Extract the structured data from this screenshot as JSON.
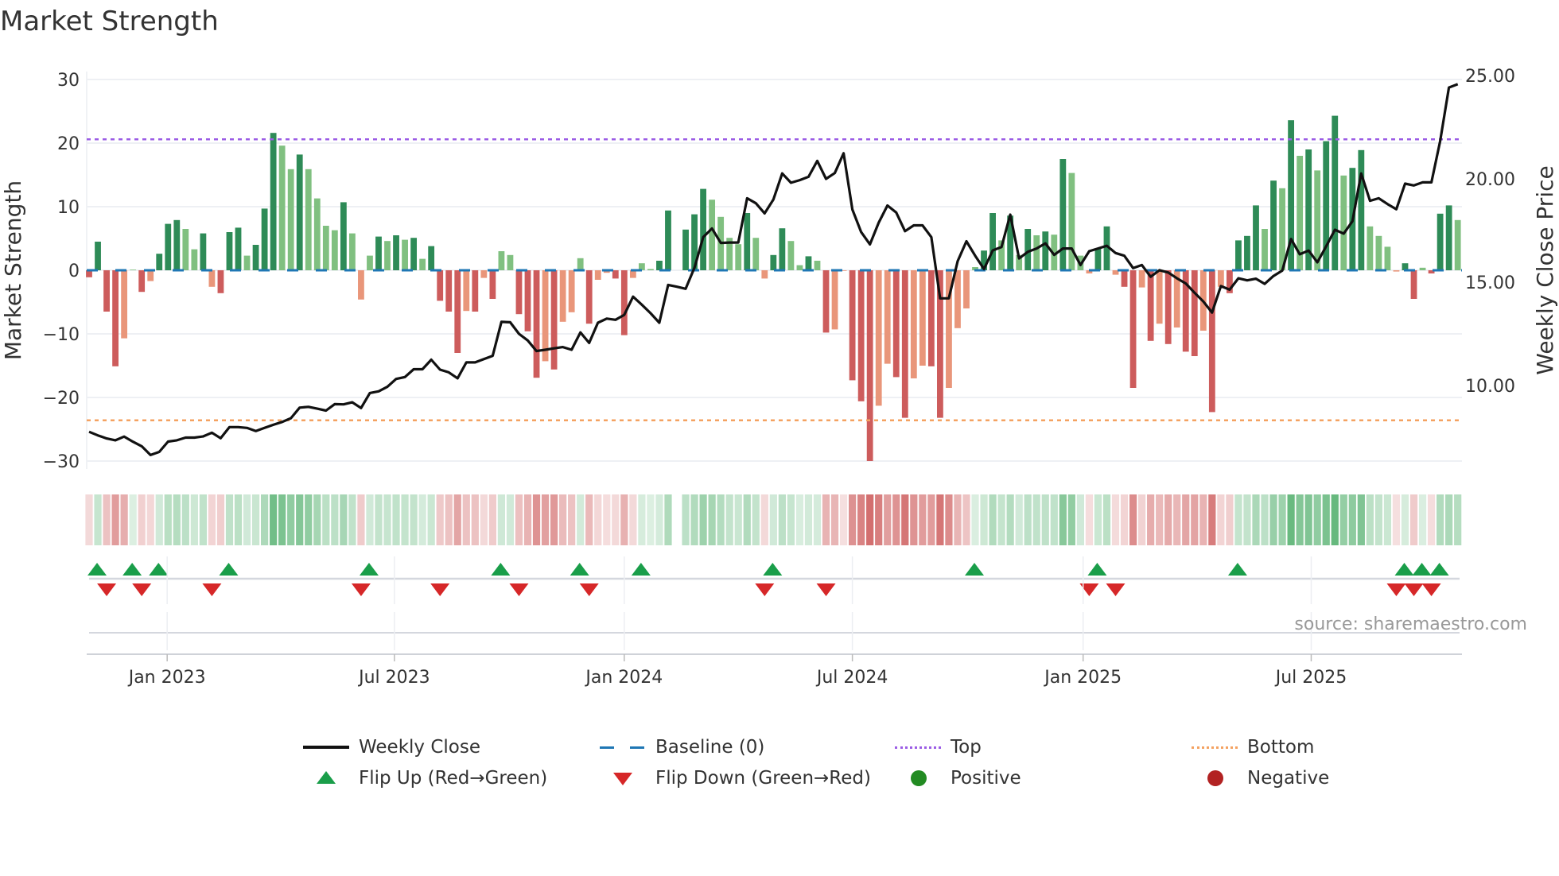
{
  "chart_data": {
    "type": "bar",
    "title": "Market Strength",
    "ylabel": "Market Strength",
    "y2label": "Weekly Close Price",
    "ylim": [
      -32,
      32
    ],
    "yticks": [
      30,
      20,
      10,
      0,
      -10,
      -20,
      -30
    ],
    "ytick_labels": [
      "30",
      "20",
      "10",
      "0",
      "−10",
      "−20",
      "−30"
    ],
    "y2ticks": [
      25,
      20,
      15,
      10
    ],
    "y2tick_labels": [
      "25.00",
      "20.00",
      "15.00",
      "10.00"
    ],
    "xticks": [
      {
        "label": "Jan 2023",
        "index": 8.9
      },
      {
        "label": "Jul 2023",
        "index": 34.8
      },
      {
        "label": "Jan 2024",
        "index": 61.0
      },
      {
        "label": "Jul 2024",
        "index": 87.0
      },
      {
        "label": "Jan 2025",
        "index": 113.3
      },
      {
        "label": "Jul 2025",
        "index": 139.3
      }
    ],
    "top_level": 20.6,
    "bottom_level": -23.6,
    "baseline": 0,
    "strength": [
      -1.1,
      4.5,
      -6.5,
      -15.1,
      -10.7,
      0.1,
      -3.4,
      -1.7,
      2.6,
      7.3,
      7.9,
      6.5,
      3.3,
      5.8,
      -2.6,
      -3.6,
      6.0,
      6.7,
      2.3,
      4.0,
      9.7,
      21.6,
      19.6,
      15.9,
      18.2,
      15.9,
      11.3,
      7.0,
      6.3,
      10.7,
      5.8,
      -4.6,
      2.3,
      5.3,
      4.6,
      5.5,
      4.8,
      5.1,
      1.8,
      3.8,
      -4.8,
      -6.5,
      -13.0,
      -6.4,
      -6.5,
      -1.2,
      -4.5,
      3.0,
      2.4,
      -6.9,
      -9.6,
      -16.9,
      -14.3,
      -15.6,
      -8.1,
      -6.6,
      1.9,
      -8.4,
      -1.5,
      -0.4,
      -1.3,
      -10.2,
      -1.2,
      1.1,
      0.2,
      1.5,
      9.4,
      0,
      6.4,
      8.8,
      12.8,
      11.1,
      8.4,
      5.1,
      4.1,
      9.0,
      5.1,
      -1.3,
      2.4,
      6.6,
      4.6,
      0.8,
      2.2,
      1.5,
      -9.8,
      -9.3,
      -0.1,
      -17.3,
      -20.6,
      -30.0,
      -21.3,
      -14.7,
      -16.8,
      -23.2,
      -17.0,
      -15.0,
      -15.1,
      -23.2,
      -18.5,
      -9.1,
      -6.0,
      0.5,
      3.1,
      9.0,
      4.7,
      8.6,
      2.4,
      6.5,
      5.5,
      6.1,
      5.6,
      17.5,
      15.3,
      2.3,
      -0.5,
      3.5,
      6.9,
      -0.7,
      -2.6,
      -18.5,
      -2.7,
      -11.1,
      -8.4,
      -11.6,
      -9.0,
      -12.8,
      -13.5,
      -9.5,
      -22.3,
      -2.6,
      -3.6,
      4.7,
      5.4,
      10.2,
      6.5,
      14.1,
      12.9,
      23.6,
      18.0,
      19.0,
      15.7,
      20.3,
      24.3,
      14.9,
      16.1,
      18.9,
      6.9,
      5.4,
      3.7,
      -0.2,
      1.1,
      -4.5,
      0.4,
      -0.5,
      8.9,
      10.2,
      7.9
    ],
    "weekly_close": [
      7.76,
      7.59,
      7.44,
      7.35,
      7.53,
      7.28,
      7.06,
      6.64,
      6.79,
      7.29,
      7.35,
      7.48,
      7.48,
      7.54,
      7.72,
      7.45,
      7.99,
      7.99,
      7.95,
      7.8,
      7.95,
      8.1,
      8.24,
      8.42,
      8.93,
      8.97,
      8.88,
      8.79,
      9.1,
      9.09,
      9.19,
      8.91,
      9.64,
      9.72,
      9.94,
      10.32,
      10.41,
      10.79,
      10.79,
      11.25,
      10.77,
      10.64,
      10.35,
      11.12,
      11.12,
      11.28,
      11.44,
      13.08,
      13.06,
      12.5,
      12.18,
      11.67,
      11.73,
      11.8,
      11.86,
      11.73,
      12.57,
      12.06,
      13.04,
      13.24,
      13.18,
      13.42,
      14.3,
      13.91,
      13.5,
      13.04,
      14.87,
      14.78,
      14.68,
      15.7,
      17.18,
      17.6,
      16.9,
      16.92,
      16.92,
      19.06,
      18.82,
      18.33,
      19.0,
      20.26,
      19.81,
      19.94,
      20.1,
      20.87,
      20.0,
      20.28,
      21.24,
      18.52,
      17.43,
      16.83,
      17.88,
      18.71,
      18.37,
      17.47,
      17.75,
      17.75,
      17.18,
      14.22,
      14.22,
      16.02,
      16.98,
      16.28,
      15.64,
      16.54,
      16.7,
      18.27,
      16.15,
      16.47,
      16.63,
      16.88,
      16.32,
      16.63,
      16.63,
      15.83,
      16.5,
      16.63,
      16.76,
      16.41,
      16.28,
      15.68,
      15.83,
      15.26,
      15.58,
      15.47,
      15.19,
      14.94,
      14.49,
      14.07,
      13.53,
      14.81,
      14.64,
      15.19,
      15.09,
      15.17,
      14.92,
      15.3,
      15.56,
      17.09,
      16.35,
      16.53,
      15.96,
      16.73,
      17.54,
      17.35,
      17.95,
      20.26,
      18.94,
      19.06,
      18.78,
      18.53,
      19.77,
      19.68,
      19.83,
      19.83,
      21.83,
      24.42,
      24.58
    ],
    "flip_up_weeks": [
      2,
      6,
      9,
      17,
      33,
      48,
      57,
      64,
      79,
      102,
      116,
      132,
      151,
      153,
      155
    ],
    "flip_down_weeks": [
      3,
      7,
      15,
      32,
      41,
      50,
      58,
      78,
      85,
      115,
      118,
      150,
      152,
      154
    ],
    "legend": {
      "weekly_close": "Weekly Close",
      "baseline": "Baseline (0)",
      "top": "Top",
      "bottom": "Bottom",
      "flip_up": "Flip Up (Red→Green)",
      "flip_down": "Flip Down (Green→Red)",
      "positive": "Positive",
      "negative": "Negative"
    },
    "annotation": "source: sharemaestro.com",
    "colors": {
      "pos_strong": "#2e8b57",
      "pos_weak": "#80c080",
      "neg_strong": "#cd5c5c",
      "neg_weak": "#e9967a",
      "line": "#111111",
      "baseline": "#1f77b4",
      "top": "#9b5de5",
      "bottom": "#f4a261",
      "flip_up": "#1a9e4a",
      "flip_down": "#d62728",
      "positive": "#228b22",
      "negative": "#b22222"
    }
  }
}
